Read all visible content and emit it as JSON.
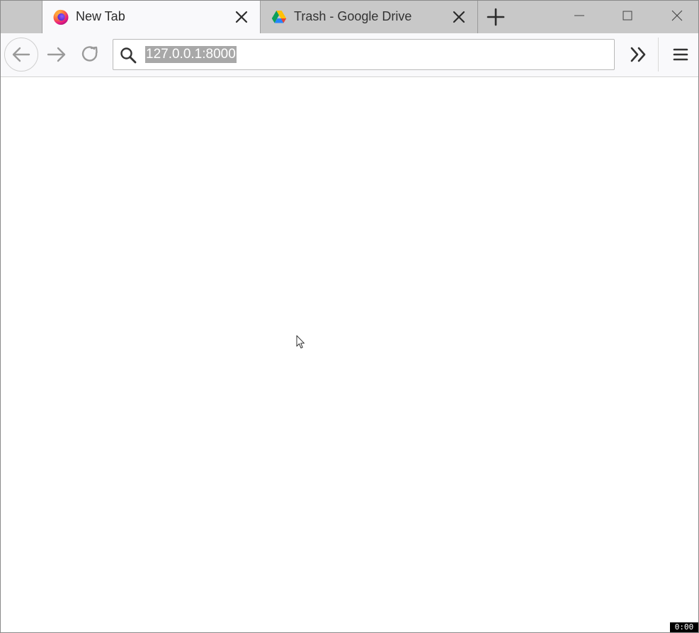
{
  "tabs": [
    {
      "title": "New Tab",
      "favicon": "firefox-icon",
      "active": true
    },
    {
      "title": "Trash - Google Drive",
      "favicon": "google-drive-icon",
      "active": false
    }
  ],
  "toolbar": {
    "url": "127.0.0.1:8000",
    "url_selected": true
  },
  "icons": {
    "new_tab": "plus-icon",
    "minimize": "minimize-icon",
    "maximize": "maximize-icon",
    "close": "close-icon",
    "back": "arrow-left-icon",
    "forward": "arrow-right-icon",
    "reload": "reload-icon",
    "search": "search-icon",
    "overflow": "chevron-double-right-icon",
    "menu": "hamburger-menu-icon"
  },
  "colors": {
    "tabstrip_bg": "#c8c8c8",
    "toolbar_bg": "#f9f9fb",
    "url_selection_bg": "#a8a8a8",
    "firefox_orange": "#ff7139",
    "firefox_purple": "#7542e5"
  },
  "overlay": {
    "timer": "0:00"
  }
}
